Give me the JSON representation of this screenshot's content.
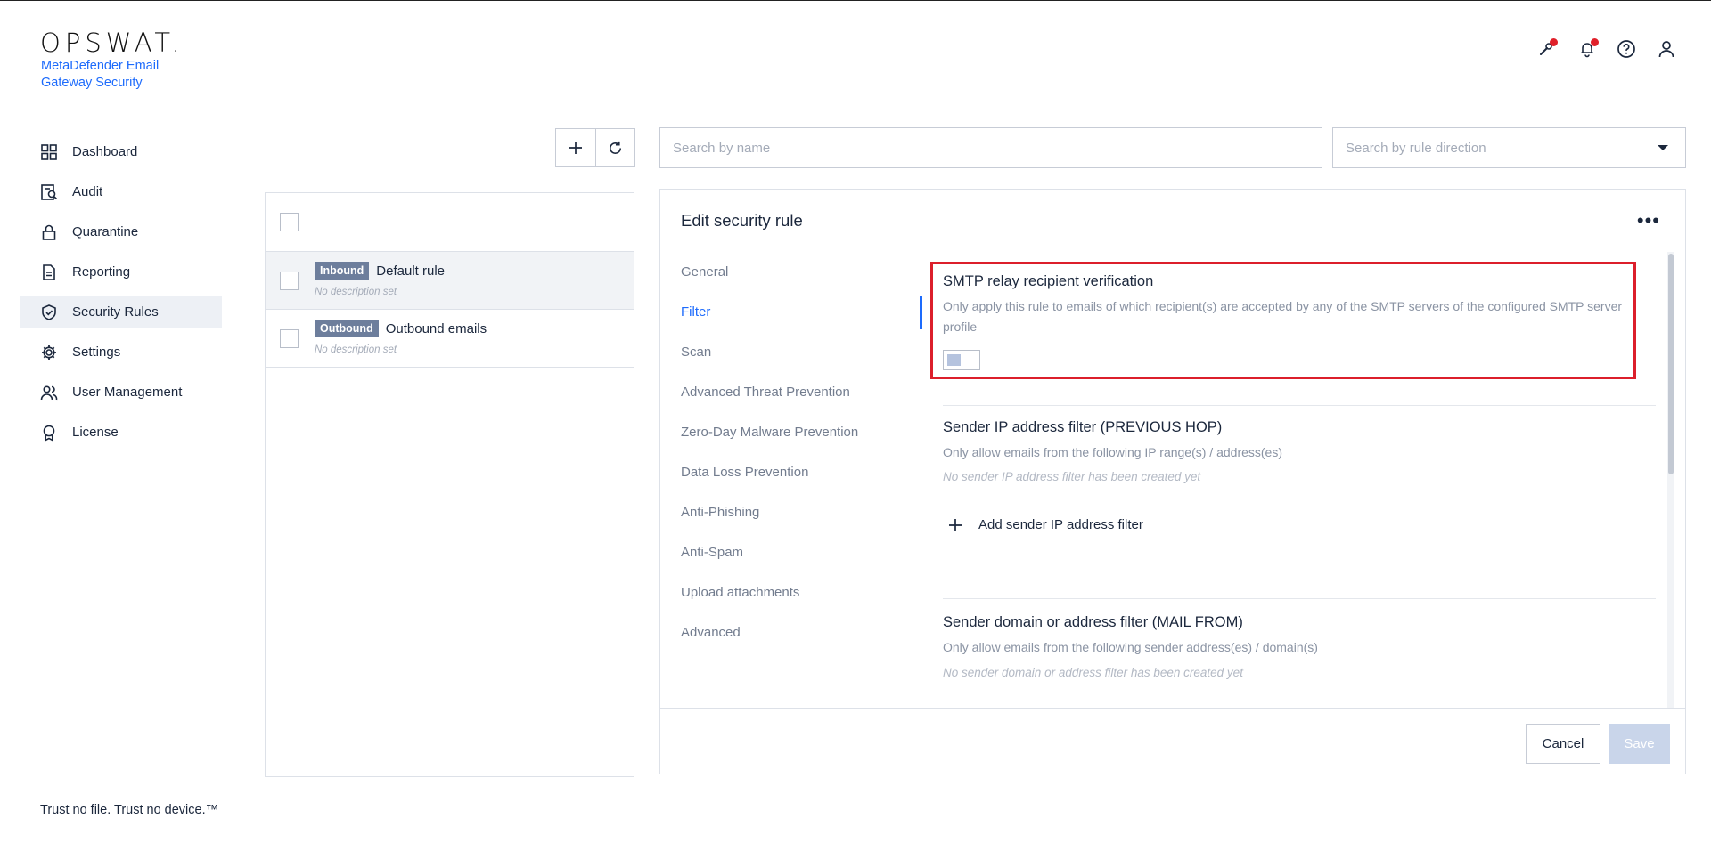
{
  "brand": {
    "logo": "OPSWAT.",
    "product": "MetaDefender Email Gateway Security",
    "tagline": "Trust no file. Trust no device.™"
  },
  "header_icons": [
    "wrench-icon",
    "bell-icon",
    "help-icon",
    "user-icon"
  ],
  "sidebar": {
    "items": [
      {
        "label": "Dashboard",
        "icon": "dashboard-icon"
      },
      {
        "label": "Audit",
        "icon": "audit-icon"
      },
      {
        "label": "Quarantine",
        "icon": "lock-icon"
      },
      {
        "label": "Reporting",
        "icon": "document-icon"
      },
      {
        "label": "Security Rules",
        "icon": "shield-check-icon",
        "active": true
      },
      {
        "label": "Settings",
        "icon": "gear-icon"
      },
      {
        "label": "User Management",
        "icon": "users-icon"
      },
      {
        "label": "License",
        "icon": "award-icon"
      }
    ]
  },
  "search": {
    "name_placeholder": "Search by name",
    "direction_placeholder": "Search by rule direction"
  },
  "rules": [
    {
      "direction": "Inbound",
      "name": "Default rule",
      "description": "No description set",
      "selected": true
    },
    {
      "direction": "Outbound",
      "name": "Outbound emails",
      "description": "No description set",
      "selected": false
    }
  ],
  "editor": {
    "title": "Edit security rule",
    "more": "•••",
    "sections": [
      "General",
      "Filter",
      "Scan",
      "Advanced Threat Prevention",
      "Zero-Day Malware Prevention",
      "Data Loss Prevention",
      "Anti-Phishing",
      "Anti-Spam",
      "Upload attachments",
      "Advanced"
    ],
    "active_section": "Filter",
    "smtp": {
      "title": "SMTP relay recipient verification",
      "description": "Only apply this rule to emails of which recipient(s) are accepted by any of the SMTP servers of the configured SMTP server profile",
      "enabled": false
    },
    "sender_ip": {
      "title": "Sender IP address filter (PREVIOUS HOP)",
      "description": "Only allow emails from the following IP range(s) / address(es)",
      "empty": "No sender IP address filter has been created yet",
      "add_label": "Add sender IP address filter"
    },
    "sender_domain": {
      "title": "Sender domain or address filter (MAIL FROM)",
      "description": "Only allow emails from the following sender address(es) / domain(s)",
      "empty": "No sender domain or address filter has been created yet"
    },
    "cancel_label": "Cancel",
    "save_label": "Save"
  }
}
